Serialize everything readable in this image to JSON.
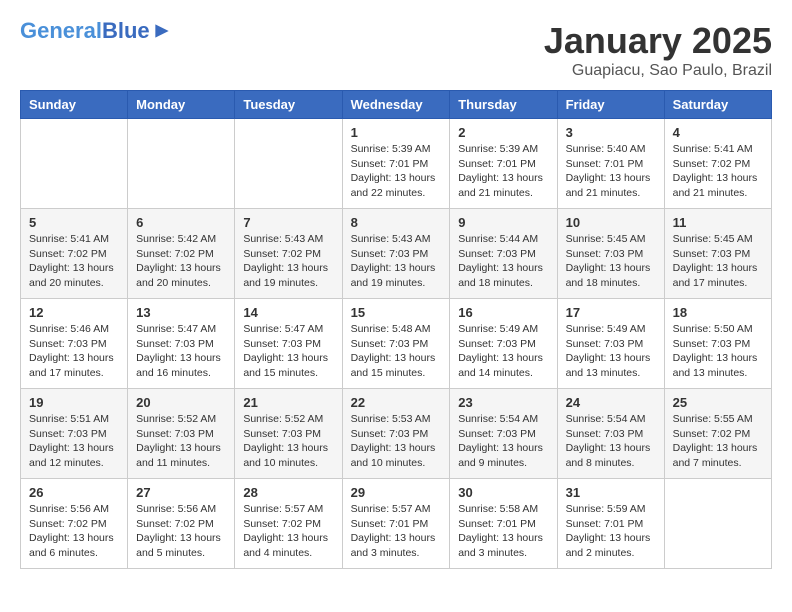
{
  "header": {
    "logo_general": "General",
    "logo_blue": "Blue",
    "title": "January 2025",
    "subtitle": "Guapiacu, Sao Paulo, Brazil"
  },
  "weekdays": [
    "Sunday",
    "Monday",
    "Tuesday",
    "Wednesday",
    "Thursday",
    "Friday",
    "Saturday"
  ],
  "weeks": [
    [
      {
        "day": "",
        "sunrise": "",
        "sunset": "",
        "daylight": ""
      },
      {
        "day": "",
        "sunrise": "",
        "sunset": "",
        "daylight": ""
      },
      {
        "day": "",
        "sunrise": "",
        "sunset": "",
        "daylight": ""
      },
      {
        "day": "1",
        "sunrise": "Sunrise: 5:39 AM",
        "sunset": "Sunset: 7:01 PM",
        "daylight": "Daylight: 13 hours and 22 minutes."
      },
      {
        "day": "2",
        "sunrise": "Sunrise: 5:39 AM",
        "sunset": "Sunset: 7:01 PM",
        "daylight": "Daylight: 13 hours and 21 minutes."
      },
      {
        "day": "3",
        "sunrise": "Sunrise: 5:40 AM",
        "sunset": "Sunset: 7:01 PM",
        "daylight": "Daylight: 13 hours and 21 minutes."
      },
      {
        "day": "4",
        "sunrise": "Sunrise: 5:41 AM",
        "sunset": "Sunset: 7:02 PM",
        "daylight": "Daylight: 13 hours and 21 minutes."
      }
    ],
    [
      {
        "day": "5",
        "sunrise": "Sunrise: 5:41 AM",
        "sunset": "Sunset: 7:02 PM",
        "daylight": "Daylight: 13 hours and 20 minutes."
      },
      {
        "day": "6",
        "sunrise": "Sunrise: 5:42 AM",
        "sunset": "Sunset: 7:02 PM",
        "daylight": "Daylight: 13 hours and 20 minutes."
      },
      {
        "day": "7",
        "sunrise": "Sunrise: 5:43 AM",
        "sunset": "Sunset: 7:02 PM",
        "daylight": "Daylight: 13 hours and 19 minutes."
      },
      {
        "day": "8",
        "sunrise": "Sunrise: 5:43 AM",
        "sunset": "Sunset: 7:03 PM",
        "daylight": "Daylight: 13 hours and 19 minutes."
      },
      {
        "day": "9",
        "sunrise": "Sunrise: 5:44 AM",
        "sunset": "Sunset: 7:03 PM",
        "daylight": "Daylight: 13 hours and 18 minutes."
      },
      {
        "day": "10",
        "sunrise": "Sunrise: 5:45 AM",
        "sunset": "Sunset: 7:03 PM",
        "daylight": "Daylight: 13 hours and 18 minutes."
      },
      {
        "day": "11",
        "sunrise": "Sunrise: 5:45 AM",
        "sunset": "Sunset: 7:03 PM",
        "daylight": "Daylight: 13 hours and 17 minutes."
      }
    ],
    [
      {
        "day": "12",
        "sunrise": "Sunrise: 5:46 AM",
        "sunset": "Sunset: 7:03 PM",
        "daylight": "Daylight: 13 hours and 17 minutes."
      },
      {
        "day": "13",
        "sunrise": "Sunrise: 5:47 AM",
        "sunset": "Sunset: 7:03 PM",
        "daylight": "Daylight: 13 hours and 16 minutes."
      },
      {
        "day": "14",
        "sunrise": "Sunrise: 5:47 AM",
        "sunset": "Sunset: 7:03 PM",
        "daylight": "Daylight: 13 hours and 15 minutes."
      },
      {
        "day": "15",
        "sunrise": "Sunrise: 5:48 AM",
        "sunset": "Sunset: 7:03 PM",
        "daylight": "Daylight: 13 hours and 15 minutes."
      },
      {
        "day": "16",
        "sunrise": "Sunrise: 5:49 AM",
        "sunset": "Sunset: 7:03 PM",
        "daylight": "Daylight: 13 hours and 14 minutes."
      },
      {
        "day": "17",
        "sunrise": "Sunrise: 5:49 AM",
        "sunset": "Sunset: 7:03 PM",
        "daylight": "Daylight: 13 hours and 13 minutes."
      },
      {
        "day": "18",
        "sunrise": "Sunrise: 5:50 AM",
        "sunset": "Sunset: 7:03 PM",
        "daylight": "Daylight: 13 hours and 13 minutes."
      }
    ],
    [
      {
        "day": "19",
        "sunrise": "Sunrise: 5:51 AM",
        "sunset": "Sunset: 7:03 PM",
        "daylight": "Daylight: 13 hours and 12 minutes."
      },
      {
        "day": "20",
        "sunrise": "Sunrise: 5:52 AM",
        "sunset": "Sunset: 7:03 PM",
        "daylight": "Daylight: 13 hours and 11 minutes."
      },
      {
        "day": "21",
        "sunrise": "Sunrise: 5:52 AM",
        "sunset": "Sunset: 7:03 PM",
        "daylight": "Daylight: 13 hours and 10 minutes."
      },
      {
        "day": "22",
        "sunrise": "Sunrise: 5:53 AM",
        "sunset": "Sunset: 7:03 PM",
        "daylight": "Daylight: 13 hours and 10 minutes."
      },
      {
        "day": "23",
        "sunrise": "Sunrise: 5:54 AM",
        "sunset": "Sunset: 7:03 PM",
        "daylight": "Daylight: 13 hours and 9 minutes."
      },
      {
        "day": "24",
        "sunrise": "Sunrise: 5:54 AM",
        "sunset": "Sunset: 7:03 PM",
        "daylight": "Daylight: 13 hours and 8 minutes."
      },
      {
        "day": "25",
        "sunrise": "Sunrise: 5:55 AM",
        "sunset": "Sunset: 7:02 PM",
        "daylight": "Daylight: 13 hours and 7 minutes."
      }
    ],
    [
      {
        "day": "26",
        "sunrise": "Sunrise: 5:56 AM",
        "sunset": "Sunset: 7:02 PM",
        "daylight": "Daylight: 13 hours and 6 minutes."
      },
      {
        "day": "27",
        "sunrise": "Sunrise: 5:56 AM",
        "sunset": "Sunset: 7:02 PM",
        "daylight": "Daylight: 13 hours and 5 minutes."
      },
      {
        "day": "28",
        "sunrise": "Sunrise: 5:57 AM",
        "sunset": "Sunset: 7:02 PM",
        "daylight": "Daylight: 13 hours and 4 minutes."
      },
      {
        "day": "29",
        "sunrise": "Sunrise: 5:57 AM",
        "sunset": "Sunset: 7:01 PM",
        "daylight": "Daylight: 13 hours and 3 minutes."
      },
      {
        "day": "30",
        "sunrise": "Sunrise: 5:58 AM",
        "sunset": "Sunset: 7:01 PM",
        "daylight": "Daylight: 13 hours and 3 minutes."
      },
      {
        "day": "31",
        "sunrise": "Sunrise: 5:59 AM",
        "sunset": "Sunset: 7:01 PM",
        "daylight": "Daylight: 13 hours and 2 minutes."
      },
      {
        "day": "",
        "sunrise": "",
        "sunset": "",
        "daylight": ""
      }
    ]
  ]
}
